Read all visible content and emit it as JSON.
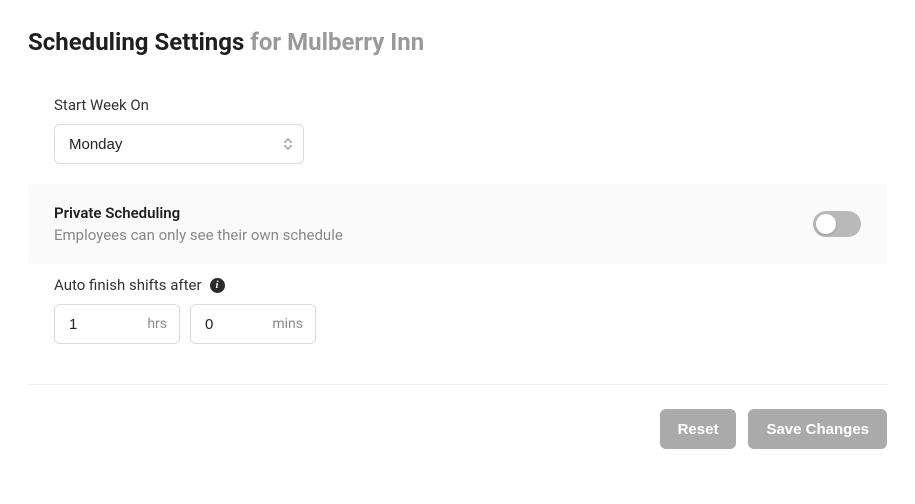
{
  "header": {
    "title": "Scheduling Settings",
    "subtitle_prefix": "for ",
    "entity_name": "Mulberry Inn"
  },
  "start_week": {
    "label": "Start Week On",
    "value": "Monday"
  },
  "private_scheduling": {
    "title": "Private Scheduling",
    "help": "Employees can only see their own schedule",
    "enabled": false
  },
  "auto_finish": {
    "label": "Auto finish shifts after",
    "hours": "1",
    "hours_unit": "hrs",
    "minutes": "0",
    "minutes_unit": "mins"
  },
  "footer": {
    "reset": "Reset",
    "save": "Save Changes"
  }
}
